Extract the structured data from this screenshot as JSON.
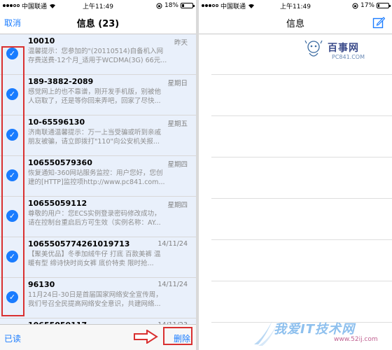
{
  "left": {
    "status": {
      "carrier": "中国联通",
      "time": "上午11:49",
      "battery_pct": "18%",
      "battery_level": 0.18
    },
    "nav": {
      "cancel": "取消",
      "title": "信息 (23)"
    },
    "messages": [
      {
        "sender": "10010",
        "date": "昨天",
        "line1": "温馨提示：您参加的\"(20110514)自备机入网",
        "line2": "存费送费-12个月_适用于WCDMA(3G) 66元..."
      },
      {
        "sender": "189-3882-2089",
        "date": "星期日",
        "line1": "感觉网上的也不靠谱，刚开发手机版，别被他",
        "line2": "人窃取了，还是等你回来弄吧，回家了尽快..."
      },
      {
        "sender": "10-65596130",
        "date": "星期五",
        "line1": "济南联通温馨提示：万一上当受骗或听到亲戚",
        "line2": "朋友被骗，请立即拨打\"110\"向公安机关报..."
      },
      {
        "sender": "106550579360",
        "date": "星期四",
        "line1": "恢复通知-360网站服务监控：用户您好，您创",
        "line2": "建的[HTTP]监控项http://www.pc841.com..."
      },
      {
        "sender": "10655059112",
        "date": "星期四",
        "line1": "尊敬的用户：您ECS实例登录密码修改成功，",
        "line2": "请在控制台重启后方可生效（实例名称：AY..."
      },
      {
        "sender": "1065505774261019713",
        "date": "14/11/24",
        "line1": "【聚美优品】冬季加绒牛仔 打底 百款美裤 温",
        "line2": "暖有型 缔诗快时尚女裤  底价特卖 限时抢..."
      },
      {
        "sender": "96130",
        "date": "14/11/24",
        "line1": "11月24日-30日是首届国家网络安全宣传周，",
        "line2": "我们号召全民提高网络安全意识，共建网络..."
      },
      {
        "sender": "10655059117",
        "date": "14/11/23",
        "line1": "",
        "line2": ""
      }
    ],
    "toolbar": {
      "read": "已读",
      "delete": "删除"
    }
  },
  "right": {
    "status": {
      "carrier": "中国联通",
      "time": "上午11:49",
      "battery_pct": "17%",
      "battery_level": 0.17
    },
    "nav": {
      "title": "信息"
    },
    "logo": {
      "text": "百事网",
      "sub": "PC841.COM"
    }
  },
  "watermark": {
    "text": "我爱IT技术网",
    "url": "www.52ij.com"
  },
  "colors": {
    "accent": "#1a7cff",
    "highlight_box": "#d93030",
    "selected_row": "#e9f0fb"
  }
}
